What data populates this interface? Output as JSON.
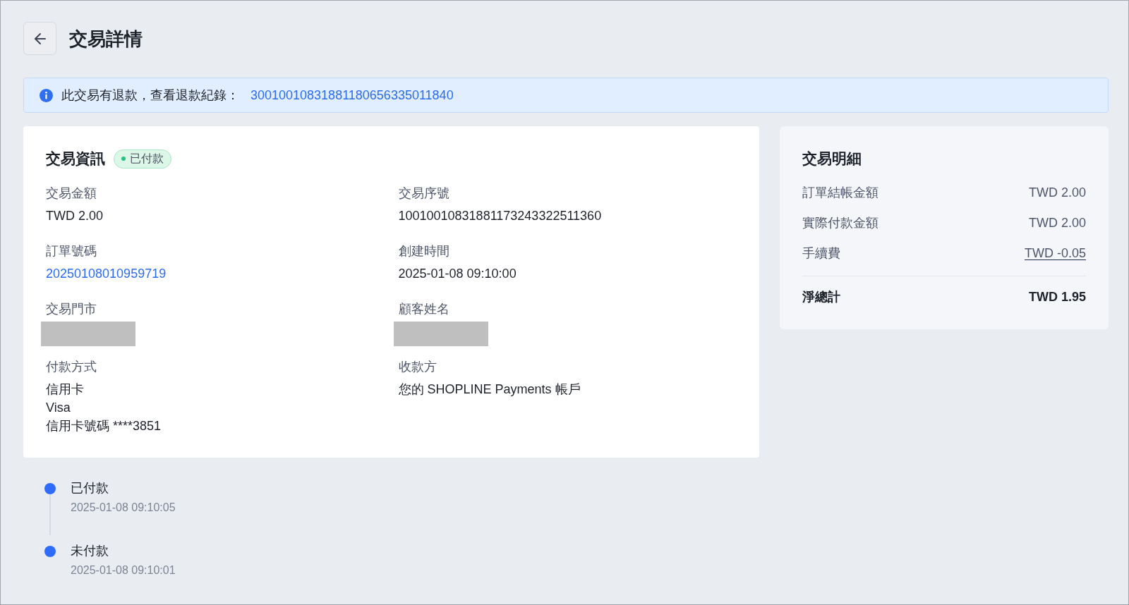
{
  "page": {
    "title": "交易詳情"
  },
  "refund_notice": {
    "text": "此交易有退款，查看退款紀錄：",
    "link": "30010010831881180656335011840"
  },
  "transaction_info": {
    "title": "交易資訊",
    "status": {
      "label": "已付款"
    },
    "fields": [
      {
        "label": "交易金額",
        "kind": "text",
        "lines": [
          "TWD 2.00"
        ]
      },
      {
        "label": "交易序號",
        "kind": "text",
        "lines": [
          "10010010831881173243322511360"
        ]
      },
      {
        "label": "訂單號碼",
        "kind": "link",
        "lines": [
          "20250108010959719"
        ]
      },
      {
        "label": "創建時間",
        "kind": "text",
        "lines": [
          "2025-01-08 09:10:00"
        ]
      },
      {
        "label": "交易門市",
        "kind": "redacted"
      },
      {
        "label": "顧客姓名",
        "kind": "redacted"
      },
      {
        "label": "付款方式",
        "kind": "text",
        "lines": [
          "信用卡",
          "Visa",
          "信用卡號碼 ****3851"
        ]
      },
      {
        "label": "收款方",
        "kind": "text",
        "lines": [
          "您的 SHOPLINE Payments 帳戶"
        ]
      }
    ]
  },
  "transaction_details": {
    "title": "交易明細",
    "rows": [
      {
        "label": "訂單結帳金額",
        "value": "TWD 2.00",
        "kind": "plain"
      },
      {
        "label": "實際付款金額",
        "value": "TWD 2.00",
        "kind": "plain"
      },
      {
        "label": "手續費",
        "value": "TWD -0.05",
        "kind": "link"
      }
    ],
    "total": {
      "label": "淨總計",
      "value": "TWD 1.95"
    }
  },
  "timeline": [
    {
      "label": "已付款",
      "time": "2025-01-08 09:10:05"
    },
    {
      "label": "未付款",
      "time": "2025-01-08 09:10:01"
    }
  ]
}
